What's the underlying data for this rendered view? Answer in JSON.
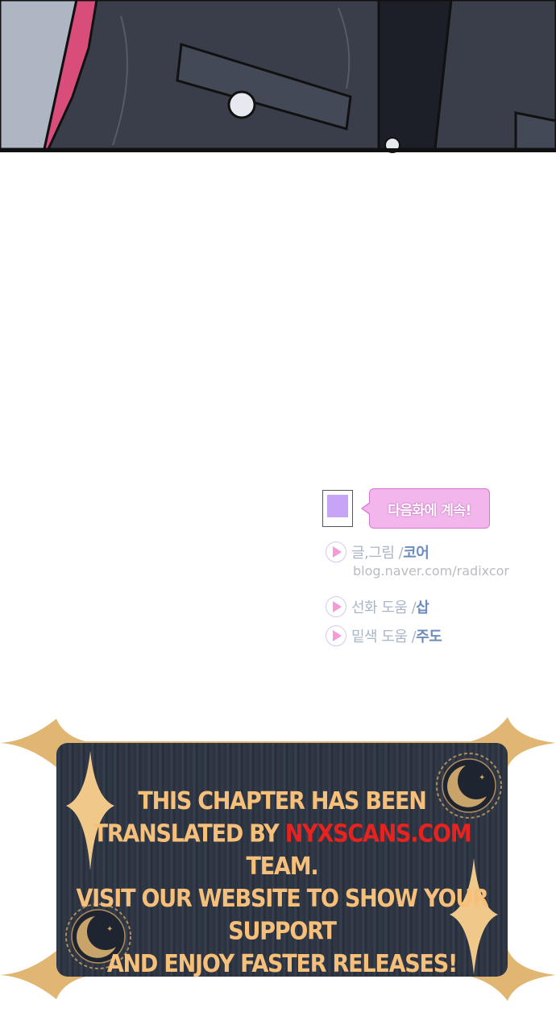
{
  "credits": {
    "next_episode": "다음화에 계속!",
    "story_art_label": "글,그림 / ",
    "story_art_name": "코어",
    "blog_url": "blog.naver.com/radixcor",
    "lineart_label": "선화 도움 / ",
    "lineart_name": "삽",
    "flat_label": "밑색 도움 / ",
    "flat_name": "주도"
  },
  "banner": {
    "line1": "THIS CHAPTER HAS BEEN",
    "line2_prefix": "TRANSLATED BY ",
    "line2_site": "NYXSCANS.COM",
    "line2_suffix": " TEAM.",
    "line3": "VISIT OUR WEBSITE TO SHOW YOUR SUPPORT",
    "line4": "AND ENJOY FASTER RELEASES!"
  },
  "colors": {
    "accent_pink": "#f3b6ec",
    "banner_text": "#f7c07a",
    "banner_site": "#e8231f",
    "gold": "#e0b672"
  }
}
